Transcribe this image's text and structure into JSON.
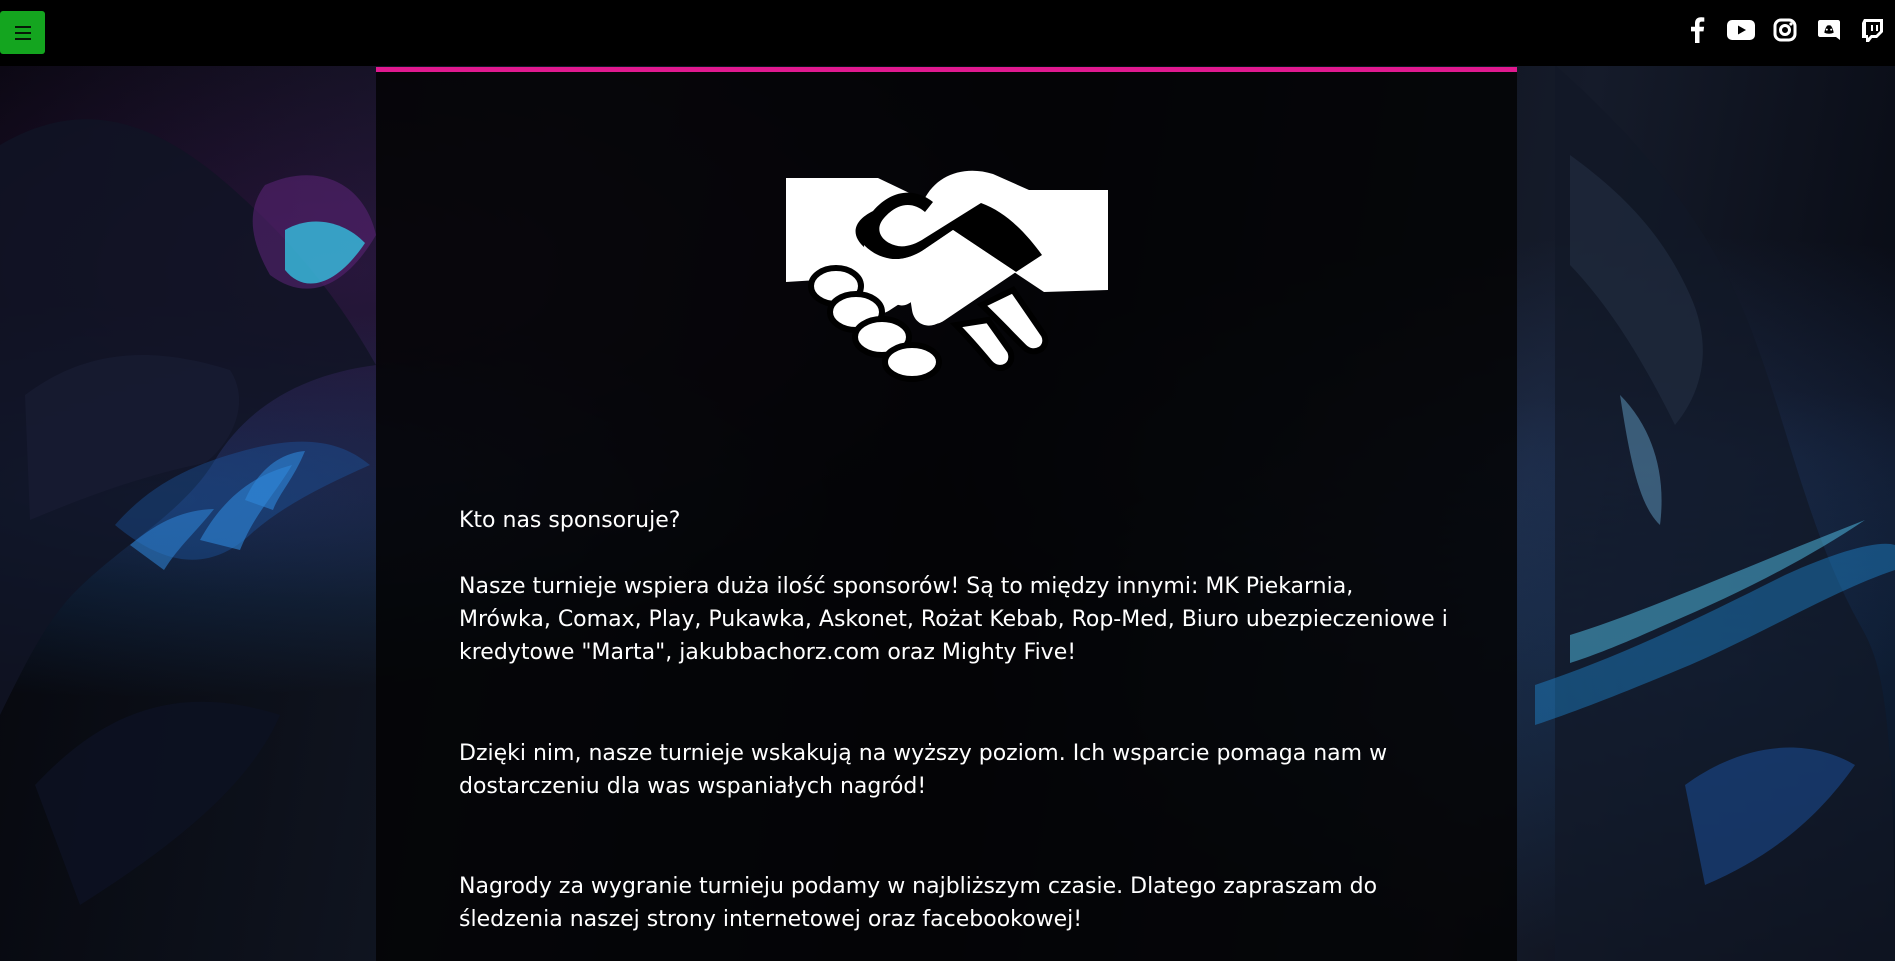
{
  "header": {
    "menu_icon": "hamburger-icon",
    "social_links": [
      {
        "name": "Facebook",
        "icon": "facebook-icon"
      },
      {
        "name": "YouTube",
        "icon": "youtube-icon"
      },
      {
        "name": "Instagram",
        "icon": "instagram-icon"
      },
      {
        "name": "Discord",
        "icon": "discord-icon"
      },
      {
        "name": "Twitch",
        "icon": "twitch-icon"
      }
    ]
  },
  "main": {
    "hero_icon": "handshake-icon",
    "question": "Kto nas sponsoruje?",
    "paragraphs": [
      "Nasze turnieje wspiera duża ilość sponsorów! Są to między innymi: MK Piekarnia, Mrówka, Comax, Play, Pukawka, Askonet, Rożat Kebab, Rop-Med, Biuro ubezpieczeniowe i kredytowe \"Marta\", jakubbachorz.com oraz Mighty Five!",
      "Dzięki nim, nasze turnieje wskakują na wyższy poziom. Ich wsparcie pomaga nam w dostarczeniu dla was wspaniałych nagród!",
      "Nagrody za wygranie turnieju podamy w najbliższym czasie. Dlatego zapraszam do śledzenia naszej strony internetowej oraz facebookowej!"
    ]
  },
  "colors": {
    "accent": "#e0198f",
    "menu_button": "#14a51f",
    "text": "#ffffff",
    "panel": "#030305"
  }
}
